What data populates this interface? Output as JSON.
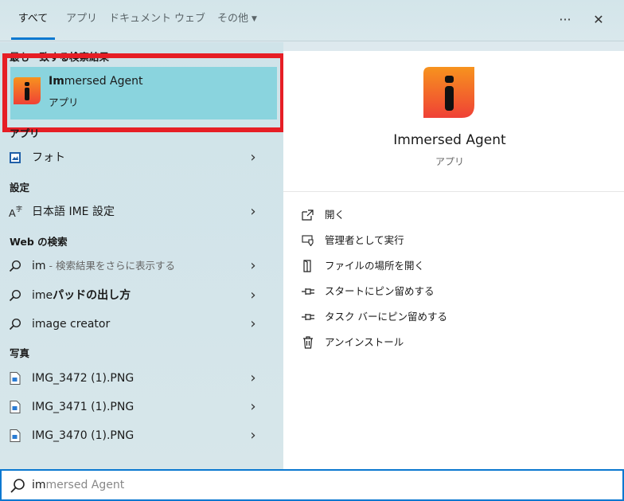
{
  "tabs": [
    {
      "label": "すべて",
      "active": true
    },
    {
      "label": "アプリ"
    },
    {
      "label": "ドキュメント"
    },
    {
      "label": "ウェブ"
    },
    {
      "label": "その他"
    }
  ],
  "topbar": {
    "more_glyph": "···",
    "close_glyph": "✕"
  },
  "sections": {
    "best_match": "最も一致する検索結果",
    "apps": "アプリ",
    "settings": "設定",
    "web": "Web の検索",
    "photos": "写真"
  },
  "best_match": {
    "title_bold": "Im",
    "title_rest": "mersed Agent",
    "subtitle": "アプリ"
  },
  "apps": [
    {
      "label": "フォト",
      "icon": "photos-icon"
    }
  ],
  "settings": [
    {
      "label": "日本語 IME 設定",
      "icon": "ime-settings-icon"
    }
  ],
  "web": [
    {
      "query": "im",
      "hint": " - 検索結果をさらに表示する"
    },
    {
      "prefix": "ime",
      "bold": "パッドの出し方"
    },
    {
      "label": "image creator"
    }
  ],
  "photos": [
    {
      "label": "IMG_3472 (1).PNG"
    },
    {
      "label": "IMG_3471 (1).PNG"
    },
    {
      "label": "IMG_3470 (1).PNG"
    }
  ],
  "detail": {
    "app_name": "Immersed Agent",
    "app_kind": "アプリ",
    "actions": [
      {
        "label": "開く",
        "icon": "open-icon"
      },
      {
        "label": "管理者として実行",
        "icon": "run-as-admin-icon"
      },
      {
        "label": "ファイルの場所を開く",
        "icon": "file-location-icon"
      },
      {
        "label": "スタートにピン留めする",
        "icon": "pin-start-icon"
      },
      {
        "label": "タスク バーにピン留めする",
        "icon": "pin-taskbar-icon"
      },
      {
        "label": "アンインストール",
        "icon": "trash-icon"
      }
    ]
  },
  "search": {
    "typed": "im",
    "completion": "mersed Agent"
  },
  "colors": {
    "accent": "#0b78d0",
    "highlight": "#8ad4de",
    "annotation_red": "#e61e25",
    "logo_orange": "#f26522",
    "logo_yellow": "#f7931e"
  }
}
